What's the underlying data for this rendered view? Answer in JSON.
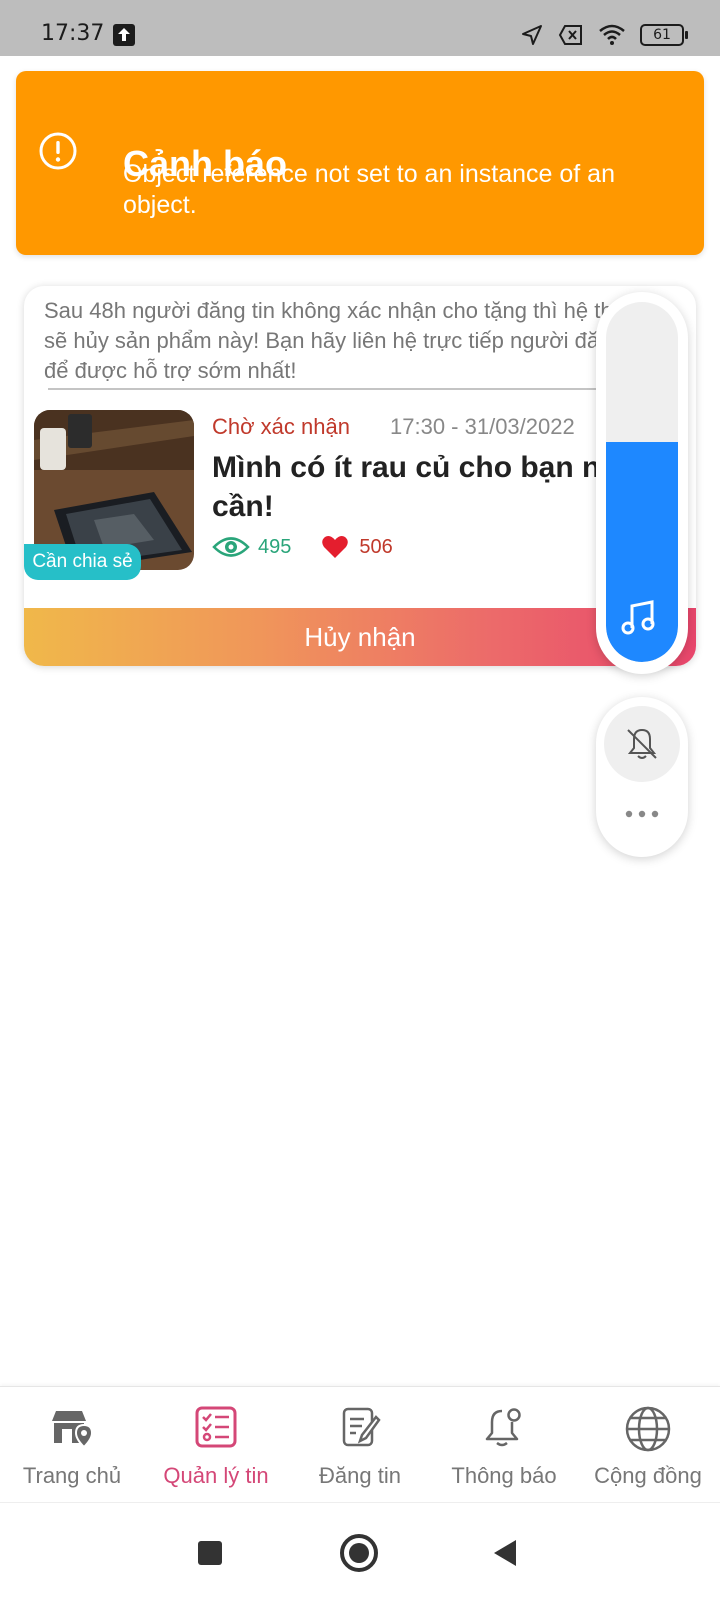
{
  "status_bar": {
    "time": "17:37",
    "battery": "61",
    "icons": [
      "upload-icon",
      "location-arrow-icon",
      "data-off-icon",
      "wifi-icon",
      "battery-icon"
    ]
  },
  "toast": {
    "title": "Cảnh báo",
    "message": "Object reference not set to an instance of an object.",
    "icon": "warning-circle-icon",
    "color": "#ff9800"
  },
  "post": {
    "notice": "Sau 48h người đăng tin không xác nhận cho tặng thì hệ thống sẽ hủy sản phẩm này! Bạn hãy liên hệ trực tiếp người đăng tin để được hỗ trợ sớm nhất!",
    "tag": "Cần chia sẻ",
    "status": "Chờ xác nhận",
    "datetime": "17:30 - 31/03/2022",
    "title": "Mình có ít rau củ cho bạn nào cần!",
    "views": "495",
    "likes": "506",
    "cancel_label": "Hủy nhận"
  },
  "volume_panel": {
    "level": 0.61,
    "accent": "#1e88ff",
    "icons": [
      "music-note-icon",
      "bell-off-icon",
      "more-dots-icon"
    ]
  },
  "bottom_nav": {
    "items": [
      {
        "label": "Trang chủ",
        "icon": "store-location-icon",
        "active": false
      },
      {
        "label": "Quản lý tin",
        "icon": "checklist-icon",
        "active": true
      },
      {
        "label": "Đăng tin",
        "icon": "edit-document-icon",
        "active": false
      },
      {
        "label": "Thông báo",
        "icon": "bell-icon",
        "active": false
      },
      {
        "label": "Cộng đồng",
        "icon": "globe-icon",
        "active": false
      }
    ],
    "active_color": "#d44777"
  }
}
